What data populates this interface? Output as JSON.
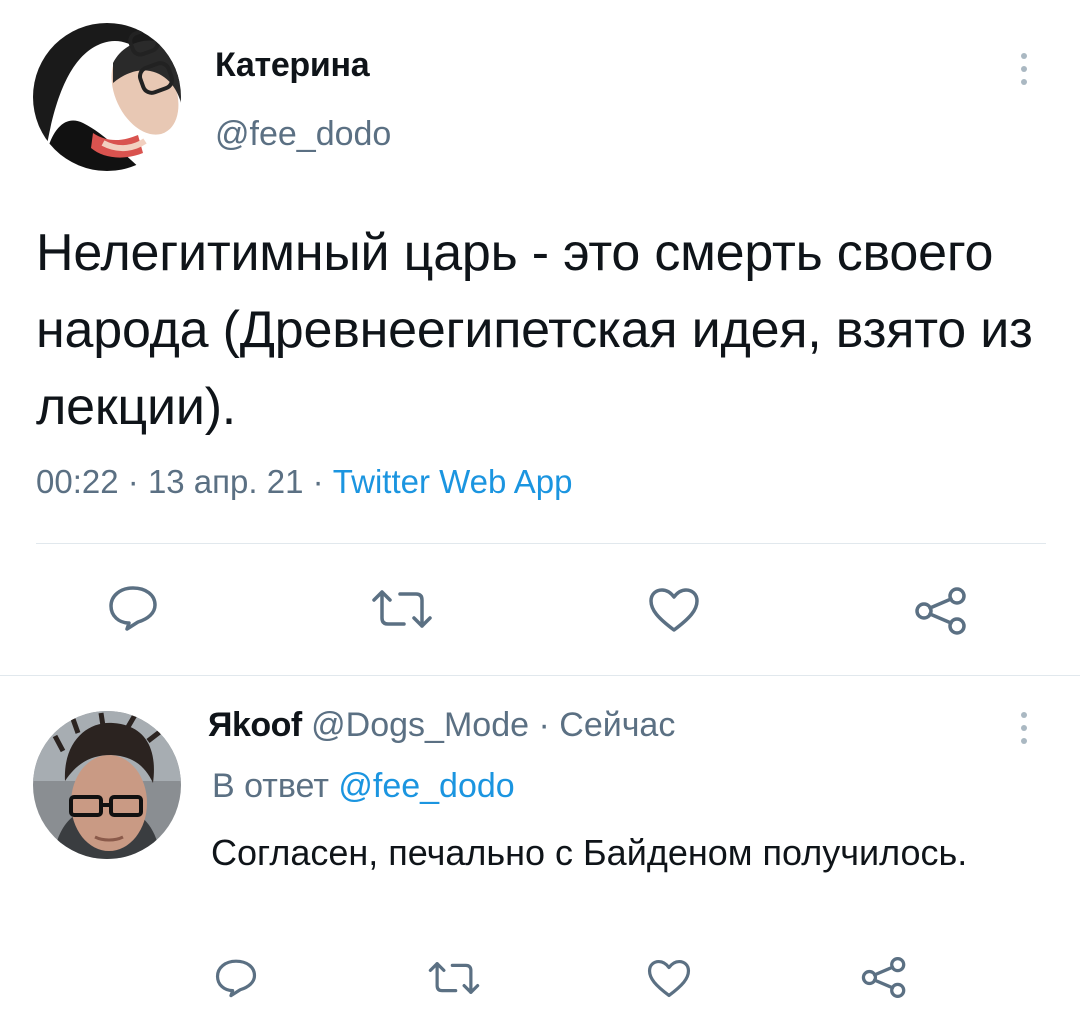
{
  "tweet": {
    "author": {
      "display_name": "Катерина",
      "handle": "@fee_dodo",
      "avatar_icon": "profile-photo"
    },
    "text": "Нелегитимный царь - это смерть своего народа (Древнеегипетская идея, взято из лекции).",
    "time": "00:22",
    "date": "13 апр. 21",
    "separator": "·",
    "source": "Twitter Web App",
    "actions": [
      {
        "name": "reply",
        "icon": "comment-icon"
      },
      {
        "name": "retweet",
        "icon": "retweet-icon"
      },
      {
        "name": "like",
        "icon": "heart-icon"
      },
      {
        "name": "share",
        "icon": "share-icon"
      }
    ]
  },
  "reply": {
    "author": {
      "display_name": "Яkoof",
      "handle": "@Dogs_Mode",
      "avatar_icon": "profile-photo"
    },
    "separator": "·",
    "time": "Сейчас",
    "replying_to_label": "В ответ",
    "replying_to_handle": "@fee_dodo",
    "text": "Согласен, печально с Байденом получилось.",
    "actions": [
      {
        "name": "reply",
        "icon": "comment-icon"
      },
      {
        "name": "retweet",
        "icon": "retweet-icon"
      },
      {
        "name": "like",
        "icon": "heart-icon"
      },
      {
        "name": "share",
        "icon": "share-icon"
      }
    ]
  },
  "colors": {
    "text": "#0f1419",
    "secondary": "#5b7083",
    "link": "#1b95e0",
    "divider": "#e1e8ed",
    "icon": "#5b7083"
  }
}
